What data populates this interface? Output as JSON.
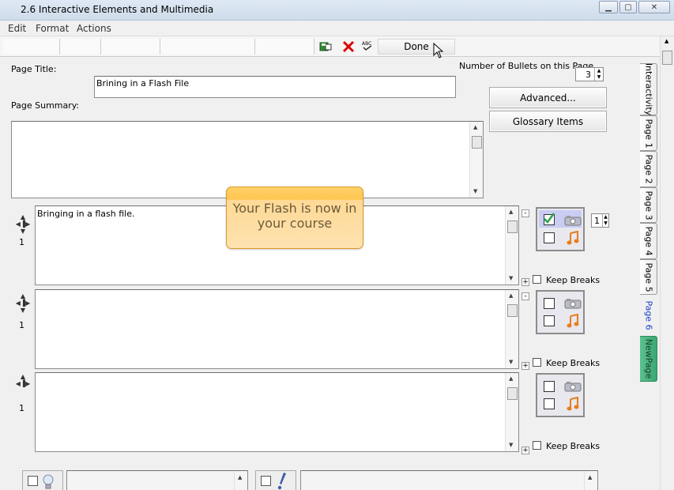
{
  "window": {
    "title": "2.6 Interactive Elements and Multimedia"
  },
  "menu": [
    "Edit",
    "Format",
    "Actions"
  ],
  "toolbar": {
    "done_label": "Done"
  },
  "page_title": {
    "label": "Page Title:",
    "value": "Brining in a Flash File"
  },
  "page_summary": {
    "label": "Page Summary:",
    "value": ""
  },
  "bullets_count": {
    "label": "Number of Bullets on this Page",
    "value": "3"
  },
  "buttons": {
    "advanced": "Advanced...",
    "glossary": "Glossary Items"
  },
  "tooltip": {
    "text": "Your Flash is now in your course"
  },
  "bullets": [
    {
      "number": "1",
      "text": "Bringing in a flash file.",
      "keep_breaks": "Keep Breaks",
      "media_spinner": "1"
    },
    {
      "number": "1",
      "text": "",
      "keep_breaks": "Keep Breaks"
    },
    {
      "number": "1",
      "text": "",
      "keep_breaks": "Keep Breaks"
    }
  ],
  "tabs": [
    "Interactivity",
    "Page 1",
    "Page 2",
    "Page 3",
    "Page 4",
    "Page 5",
    "Page 6",
    "NewPage"
  ],
  "colors": {
    "tooltip_border": "#d99a2b",
    "active_tab_text": "#1a3fc4",
    "newpage_tab": "#3aa873"
  }
}
